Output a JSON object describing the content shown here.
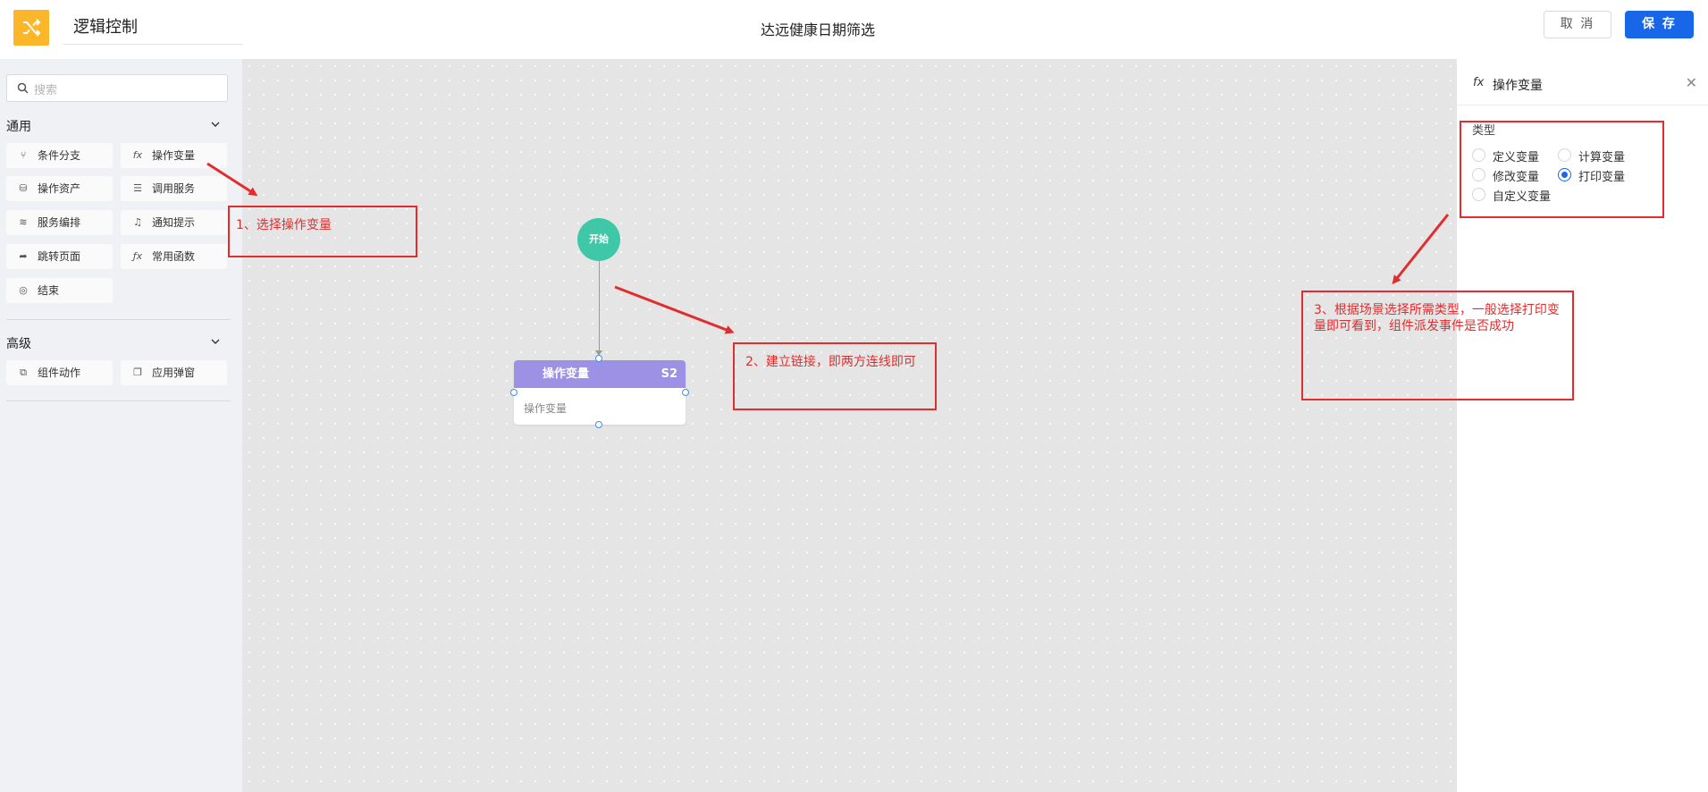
{
  "header": {
    "logo_icon": "shuffle-icon",
    "logo_color": "#fbb62a",
    "title_value": "逻辑控制",
    "page_title": "达远健康日期筛选",
    "cancel_label": "取 消",
    "save_label": "保 存",
    "save_color": "#1767e8"
  },
  "sidebar": {
    "search_placeholder": "搜索",
    "sections": [
      {
        "label": "通用",
        "items": [
          {
            "label": "条件分支",
            "icon": "branch-icon"
          },
          {
            "label": "操作变量",
            "icon": "fx-icon"
          },
          {
            "label": "操作资产",
            "icon": "database-icon"
          },
          {
            "label": "调用服务",
            "icon": "service-icon"
          },
          {
            "label": "服务编排",
            "icon": "orchestration-icon"
          },
          {
            "label": "通知提示",
            "icon": "bell-icon"
          },
          {
            "label": "跳转页面",
            "icon": "redirect-icon"
          },
          {
            "label": "常用函数",
            "icon": "function-icon"
          },
          {
            "label": "结束",
            "icon": "end-icon"
          }
        ]
      },
      {
        "label": "高级",
        "items": [
          {
            "label": "组件动作",
            "icon": "component-action-icon"
          },
          {
            "label": "应用弹窗",
            "icon": "popup-icon"
          }
        ]
      }
    ]
  },
  "canvas": {
    "start_node_label": "开始",
    "start_color": "#3ec8a8",
    "op_node": {
      "title": "操作变量",
      "tag": "S2",
      "body": "操作变量",
      "header_color": "#9c91e4"
    }
  },
  "panel": {
    "icon": "fx",
    "title": "操作变量",
    "close_icon": "close-icon",
    "type_label": "类型",
    "options": [
      {
        "label": "定义变量",
        "selected": false
      },
      {
        "label": "计算变量",
        "selected": false
      },
      {
        "label": "修改变量",
        "selected": false
      },
      {
        "label": "打印变量",
        "selected": true
      },
      {
        "label": "自定义变量",
        "selected": false
      }
    ]
  },
  "annotations": {
    "color": "#e12d2d",
    "step1": "1、选择操作变量",
    "step2": "2、建立链接，即两方连线即可",
    "step3": "3、根据场景选择所需类型，一般选择打印变量即可看到，组件派发事件是否成功"
  }
}
